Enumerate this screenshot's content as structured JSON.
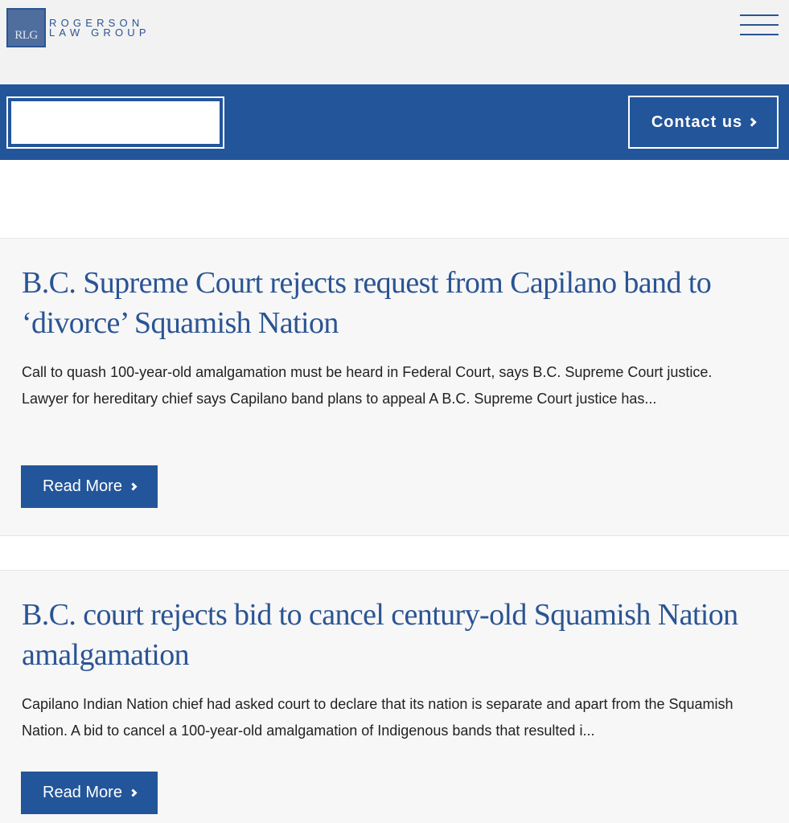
{
  "header": {
    "logo": {
      "monogram": "RLG",
      "line1": "ROGERSON",
      "line2": "LAW GROUP"
    },
    "menu_icon": "hamburger-menu-icon"
  },
  "toolbar": {
    "search_placeholder": "",
    "contact_label": "Contact us"
  },
  "articles": [
    {
      "title": "B.C. Supreme Court rejects request from Capilano band to ‘divorce’ Squamish Nation",
      "excerpt": "Call to quash 100-year-old amalgamation must be heard in Federal Court, says B.C. Supreme Court justice. Lawyer for hereditary chief says Capilano band plans to appeal A B.C. Supreme Court justice has...",
      "button_label": "Read More"
    },
    {
      "title": "B.C. court rejects bid to cancel century-old Squamish Nation amalgamation",
      "excerpt": "Capilano Indian Nation chief had asked court to declare that its nation is separate and apart from the Squamish Nation. A bid to cancel a 100-year-old amalgamation of Indigenous bands that resulted i...",
      "button_label": "Read More"
    }
  ],
  "colors": {
    "brand_blue": "#23559a",
    "title_blue": "#2a5494",
    "card_bg": "#f7f7f7",
    "header_bg": "#f2f2f2"
  }
}
